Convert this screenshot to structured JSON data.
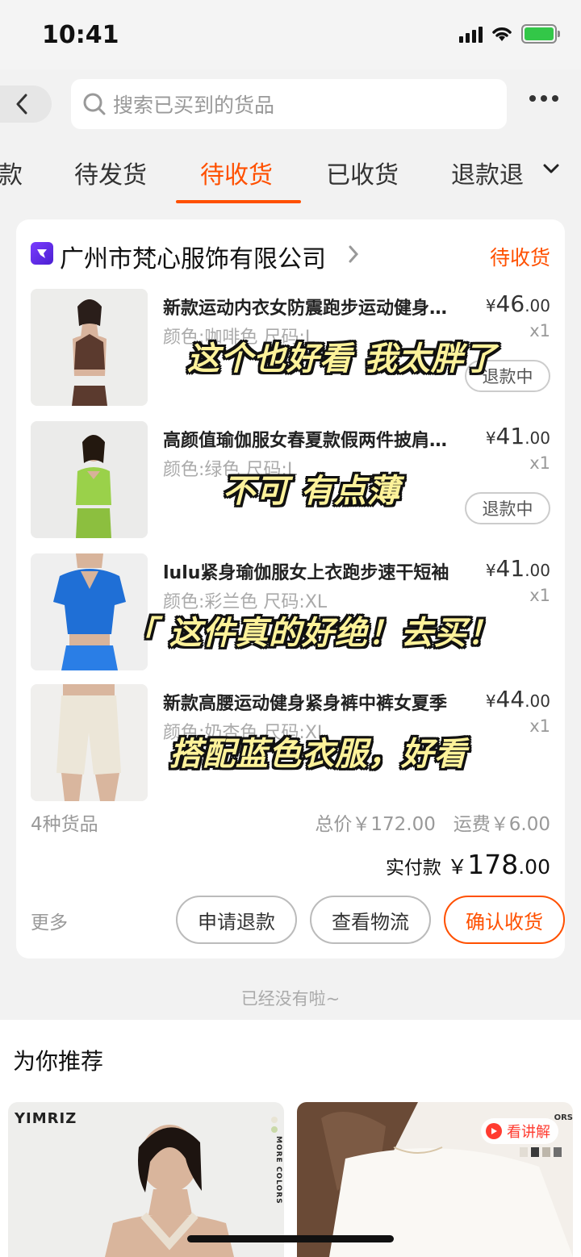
{
  "status_bar": {
    "time": "10:41"
  },
  "search": {
    "placeholder": "搜索已买到的货品"
  },
  "tabs": [
    {
      "label": "款",
      "active": false
    },
    {
      "label": "待发货",
      "active": false
    },
    {
      "label": "待收货",
      "active": true
    },
    {
      "label": "已收货",
      "active": false
    },
    {
      "label": "退款退",
      "active": false
    }
  ],
  "order": {
    "shop_name": "广州市梵心服饰有限公司",
    "status": "待收货",
    "items": [
      {
        "title": "新款运动内衣女防震跑步运动健身背心",
        "spec": "颜色:咖啡色 尺码:L",
        "price_symbol": "¥",
        "price_int": "46",
        "price_dec": ".00",
        "qty": "x1",
        "refund": "退款中"
      },
      {
        "title": "高颜值瑜伽服女春夏款假两件披肩上衣",
        "spec": "颜色:绿色 尺码:L",
        "price_symbol": "¥",
        "price_int": "41",
        "price_dec": ".00",
        "qty": "x1",
        "refund": "退款中"
      },
      {
        "title": "lulu紧身瑜伽服女上衣跑步速干短袖",
        "spec": "颜色:彩兰色 尺码:XL",
        "price_symbol": "¥",
        "price_int": "41",
        "price_dec": ".00",
        "qty": "x1",
        "refund": ""
      },
      {
        "title": "新款高腰运动健身紧身裤中裤女夏季",
        "spec": "颜色:奶杏色 尺码:XL",
        "price_symbol": "¥",
        "price_int": "44",
        "price_dec": ".00",
        "qty": "x1",
        "refund": ""
      }
    ],
    "count_text": "4种货品",
    "total_text": "总价￥172.00",
    "shipping_text": "运费￥6.00",
    "paid_label": "实付款",
    "paid_symbol": "￥",
    "paid_int": "178",
    "paid_dec": ".00",
    "more_label": "更多",
    "actions": {
      "refund": "申请退款",
      "logistics": "查看物流",
      "confirm": "确认收货"
    }
  },
  "end_text": "已经没有啦~",
  "recommend": {
    "title": "为你推荐",
    "card1_brand": "YIMRIZ",
    "card1_side": "MORE COLORS",
    "card2_badge": "看讲解",
    "card2_side": "ORS"
  },
  "captions": [
    "这个也好看 我太胖了",
    "不可 有点薄",
    "「 这件真的好绝！去买！",
    "搭配蓝色衣服，好看"
  ],
  "colors": {
    "accent": "#ff5000",
    "caption_fill": "#fdf29a",
    "caption_stroke": "#111111"
  }
}
